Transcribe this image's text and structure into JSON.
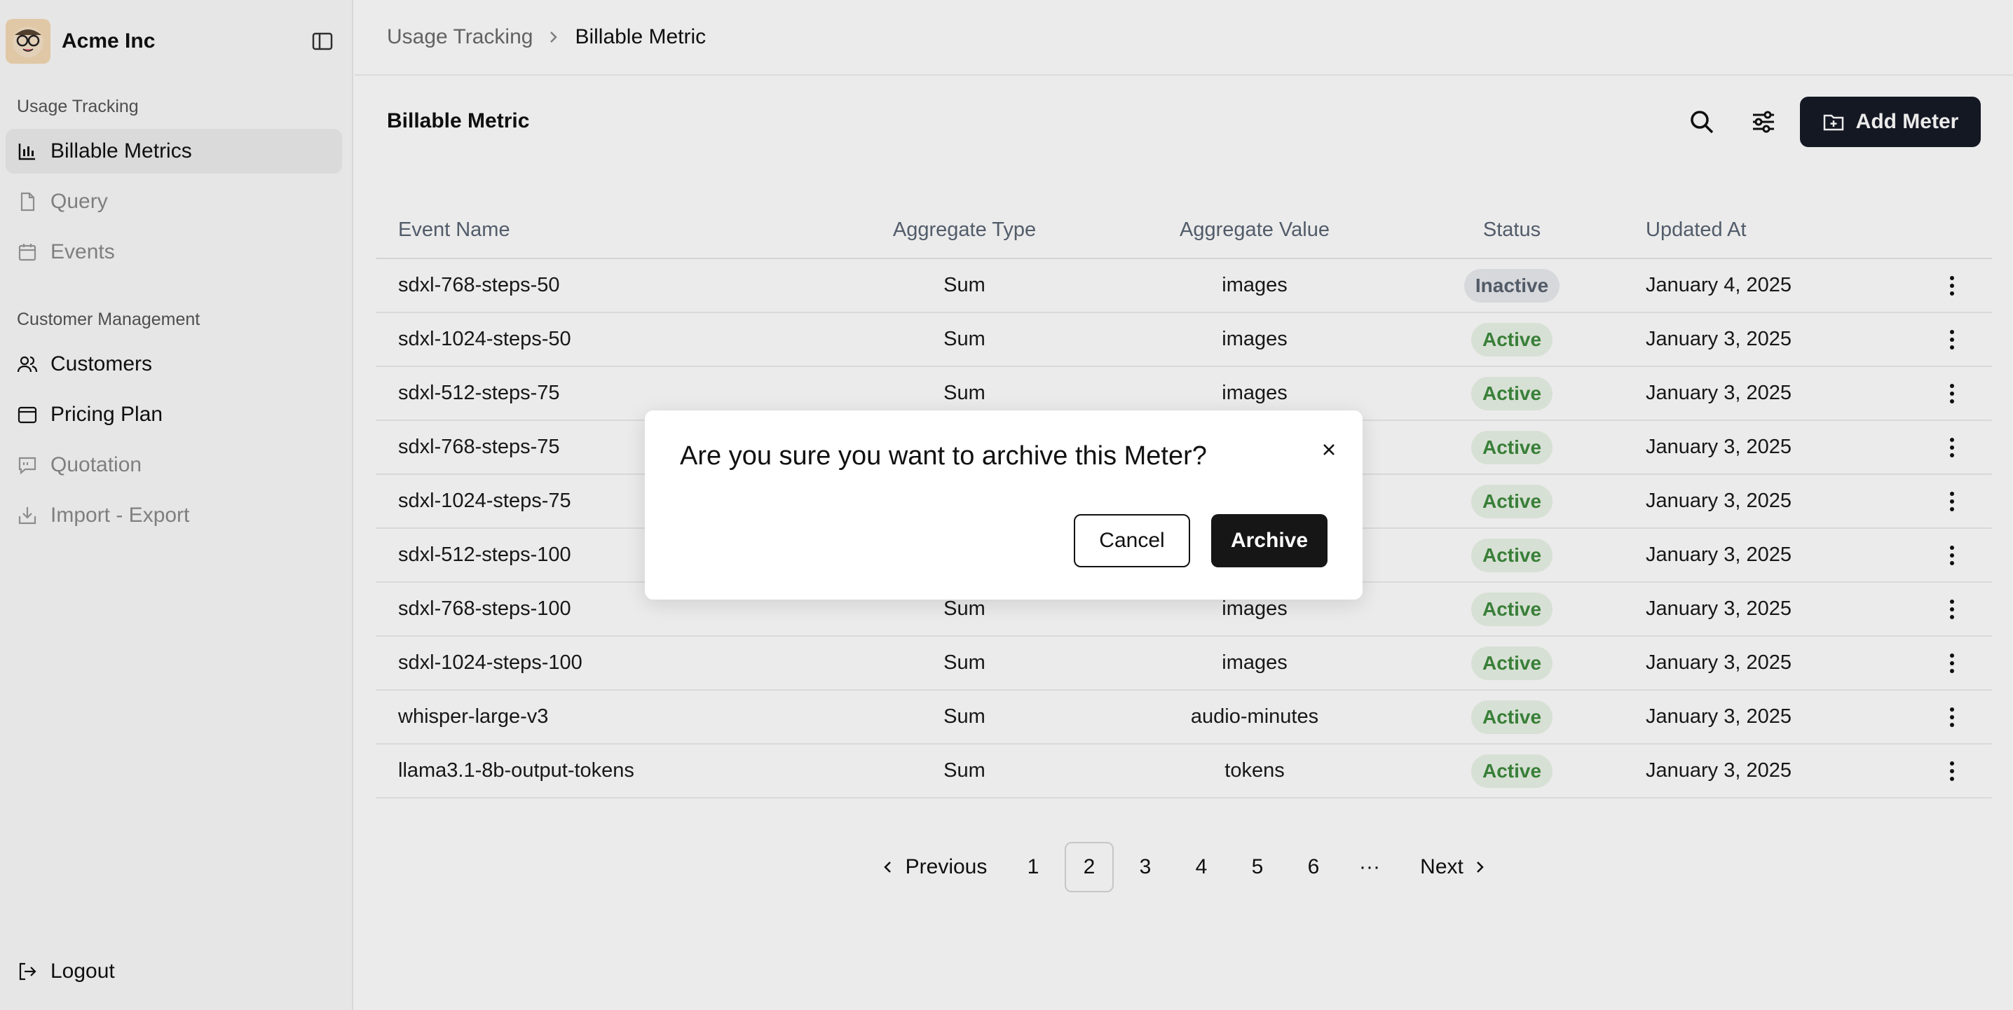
{
  "brand": {
    "name": "Acme Inc"
  },
  "sidebar": {
    "sections": [
      {
        "title": "Usage Tracking",
        "items": [
          {
            "label": "Billable Metrics",
            "icon": "chart-icon",
            "state": "active"
          },
          {
            "label": "Query",
            "icon": "file-icon",
            "state": "muted"
          },
          {
            "label": "Events",
            "icon": "calendar-icon",
            "state": "muted"
          }
        ]
      },
      {
        "title": "Customer Management",
        "items": [
          {
            "label": "Customers",
            "icon": "users-icon",
            "state": "normal"
          },
          {
            "label": "Pricing Plan",
            "icon": "wallet-icon",
            "state": "normal"
          },
          {
            "label": "Quotation",
            "icon": "message-icon",
            "state": "muted"
          },
          {
            "label": "Import - Export",
            "icon": "import-icon",
            "state": "muted"
          }
        ]
      }
    ],
    "logout": "Logout"
  },
  "breadcrumb": {
    "parent": "Usage Tracking",
    "current": "Billable Metric"
  },
  "page": {
    "title": "Billable Metric",
    "add_button": "Add Meter"
  },
  "table": {
    "headers": [
      "Event Name",
      "Aggregate Type",
      "Aggregate Value",
      "Status",
      "Updated At"
    ],
    "rows": [
      {
        "name": "sdxl-768-steps-50",
        "type": "Sum",
        "value": "images",
        "status": "Inactive",
        "updated": "January 4, 2025"
      },
      {
        "name": "sdxl-1024-steps-50",
        "type": "Sum",
        "value": "images",
        "status": "Active",
        "updated": "January 3, 2025"
      },
      {
        "name": "sdxl-512-steps-75",
        "type": "Sum",
        "value": "images",
        "status": "Active",
        "updated": "January 3, 2025"
      },
      {
        "name": "sdxl-768-steps-75",
        "type": "",
        "value": "",
        "status": "Active",
        "updated": "January 3, 2025"
      },
      {
        "name": "sdxl-1024-steps-75",
        "type": "",
        "value": "",
        "status": "Active",
        "updated": "January 3, 2025"
      },
      {
        "name": "sdxl-512-steps-100",
        "type": "",
        "value": "",
        "status": "Active",
        "updated": "January 3, 2025"
      },
      {
        "name": "sdxl-768-steps-100",
        "type": "Sum",
        "value": "images",
        "status": "Active",
        "updated": "January 3, 2025"
      },
      {
        "name": "sdxl-1024-steps-100",
        "type": "Sum",
        "value": "images",
        "status": "Active",
        "updated": "January 3, 2025"
      },
      {
        "name": "whisper-large-v3",
        "type": "Sum",
        "value": "audio-minutes",
        "status": "Active",
        "updated": "January 3, 2025"
      },
      {
        "name": "llama3.1-8b-output-tokens",
        "type": "Sum",
        "value": "tokens",
        "status": "Active",
        "updated": "January 3, 2025"
      }
    ]
  },
  "pagination": {
    "previous": "Previous",
    "next": "Next",
    "pages": [
      "1",
      "2",
      "3",
      "4",
      "5",
      "6"
    ],
    "current": "2",
    "ellipsis": "···"
  },
  "modal": {
    "title": "Are you sure you want to archive this Meter?",
    "cancel": "Cancel",
    "confirm": "Archive"
  },
  "colors": {
    "primary": "#161b26",
    "active_badge": "#eaf3e6",
    "active_text": "#3d8a3d",
    "inactive_badge": "#e9ebee"
  }
}
